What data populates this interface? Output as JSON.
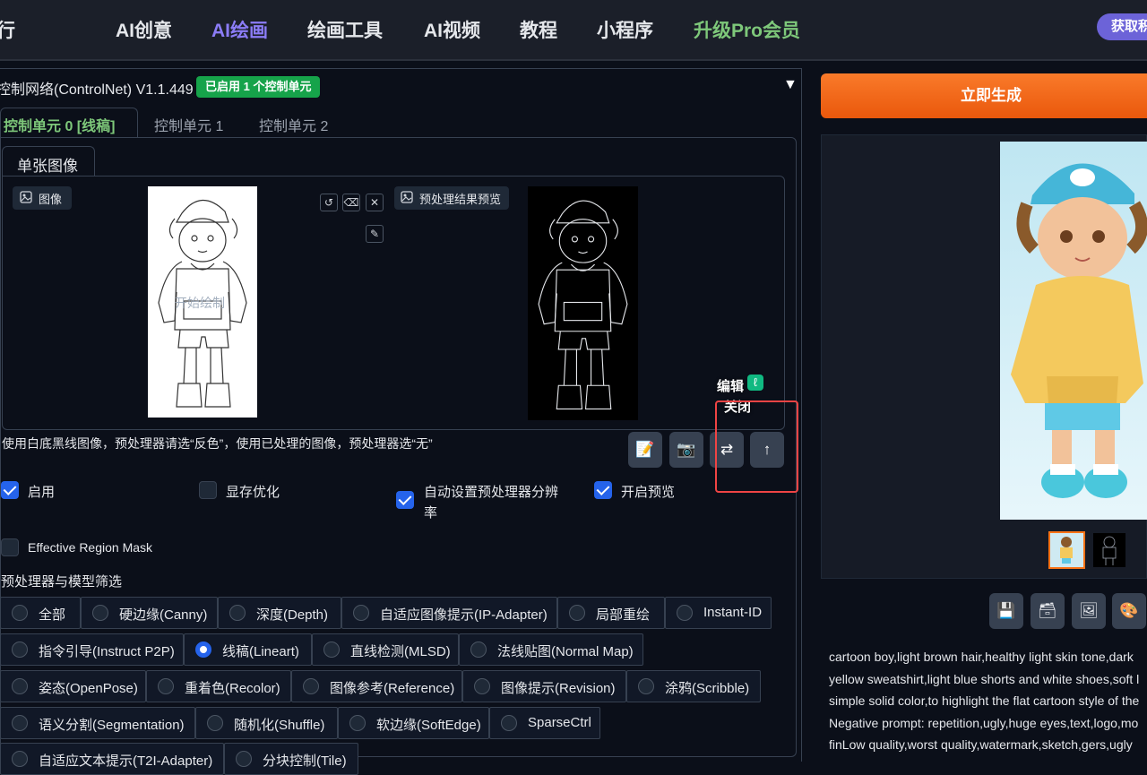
{
  "nav": {
    "partial_left": "行",
    "items": [
      "AI创意",
      "AI绘画",
      "绘画工具",
      "AI视频",
      "教程",
      "小程序",
      "升级Pro会员"
    ],
    "pill": "获取积"
  },
  "controlnet": {
    "title": "控制网络(ControlNet) V1.1.449",
    "badge": "已启用 1 个控制单元",
    "collapse_icon": "▼",
    "tabs": [
      "控制单元 0 [线稿]",
      "控制单元 1",
      "控制单元 2"
    ],
    "subtab": "单张图像",
    "image_label": "图像",
    "watermark": "开始绘制",
    "preview_label": "预处理结果预览",
    "edit_label": "编辑",
    "close_label": "关闭",
    "hint": "使用白底黑线图像，预处理器请选“反色”，使用已处理的图像，预处理器选“无”"
  },
  "options": {
    "enable": "启用",
    "vram": "显存优化",
    "auto_res": "自动设置预处理器分辨",
    "auto_res2": "率",
    "preview": "开启预览",
    "region_mask": "Effective Region Mask",
    "filter_title": "预处理器与模型筛选"
  },
  "radios": {
    "row1": [
      "全部",
      "硬边缘(Canny)",
      "深度(Depth)",
      "自适应图像提示(IP-Adapter)",
      "局部重绘",
      "Instant-ID"
    ],
    "row2": [
      "指令引导(Instruct P2P)",
      "线稿(Lineart)",
      "直线检测(MLSD)",
      "法线贴图(Normal Map)"
    ],
    "row3": [
      "姿态(OpenPose)",
      "重着色(Recolor)",
      "图像参考(Reference)",
      "图像提示(Revision)",
      "涂鸦(Scribble)"
    ],
    "row4": [
      "语义分割(Segmentation)",
      "随机化(Shuffle)",
      "软边缘(SoftEdge)",
      "SparseCtrl"
    ],
    "row5": [
      "自适应文本提示(T2I-Adapter)",
      "分块控制(Tile)"
    ],
    "selected": "线稿(Lineart)"
  },
  "right": {
    "generate": "立即生成",
    "prompt_lines": [
      "cartoon boy,light brown hair,healthy light skin tone,dark",
      "yellow sweatshirt,light blue shorts and white shoes,soft l",
      "simple solid color,to highlight the flat cartoon style of the",
      "Negative prompt: repetition,ugly,huge eyes,text,logo,mo",
      "finLow quality,worst quality,watermark,sketch,gers,ugly"
    ]
  },
  "colors": {
    "accent_purple": "#8b7cf6",
    "pro_green": "#7ec87a",
    "badge_green": "#16a34a",
    "generate_orange": "#f97316",
    "highlight_red": "#ef4444",
    "check_blue": "#2563eb"
  }
}
